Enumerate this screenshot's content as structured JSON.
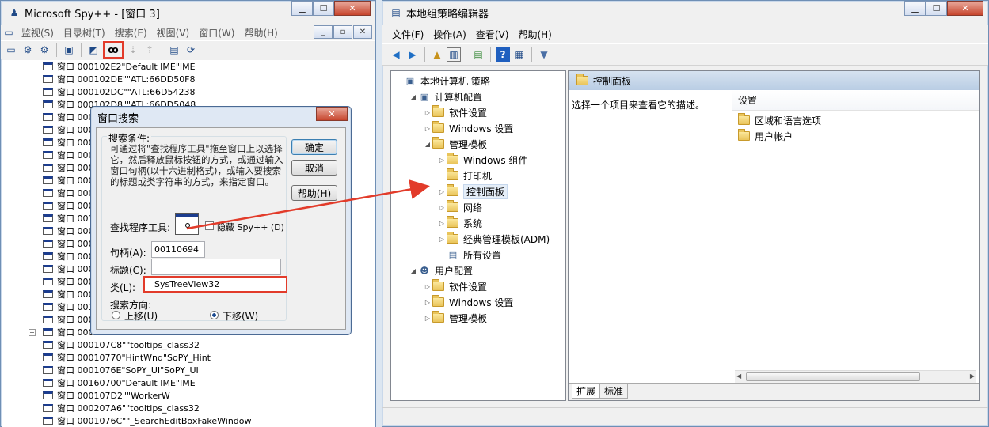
{
  "spy": {
    "title": "Microsoft Spy++ - [窗口 3]",
    "menu": [
      "监视(S)",
      "目录树(T)",
      "搜索(E)",
      "视图(V)",
      "窗口(W)",
      "帮助(H)"
    ],
    "tree": [
      "窗口 000102E2\"Default IME\"IME",
      "窗口 000102DE\"\"ATL:66DD50F8",
      "窗口 000102DC\"\"ATL:66D54238",
      "窗口 000102D8\"\"ATL:66DD5048",
      "窗口 000",
      "窗口 000",
      "窗口 000",
      "窗口 000",
      "窗口 000",
      "窗口 000",
      "窗口 000",
      "窗口 000",
      "窗口 001",
      "窗口 000",
      "窗口 000",
      "窗口 000",
      "窗口 000",
      "窗口 000",
      "窗口 000",
      "窗口 001",
      "窗口 000",
      "窗口 000",
      "窗口 000107C8\"\"tooltips_class32",
      "窗口 00010770\"HintWnd\"SoPY_Hint",
      "窗口 0001076E\"SoPY_UI\"SoPY_UI",
      "窗口 00160700\"Default IME\"IME",
      "窗口 000107D2\"\"WorkerW",
      "窗口 000207A6\"\"tooltips_class32",
      "窗口 0001076C\"\"_SearchEditBoxFakeWindow"
    ]
  },
  "dialog": {
    "title": "窗口搜索",
    "group_label": "搜索条件:",
    "description": "可通过将\"查找程序工具\"拖至窗口上以选择它，然后释放鼠标按钮的方式，或通过输入窗口句柄(以十六进制格式)，或输入要搜索的标题或类字符串的方式，来指定窗口。",
    "ok": "确定",
    "cancel": "取消",
    "help": "帮助(H)",
    "finder_label": "查找程序工具:",
    "hide_label": "隐藏 Spy++ (D)",
    "handle_label": "句柄(A):",
    "handle_value": "00110694",
    "caption_label": "标题(C):",
    "caption_value": "",
    "class_label": "类(L):",
    "class_value": "SysTreeView32",
    "direction_label": "搜索方向:",
    "up_label": "上移(U)",
    "down_label": "下移(W)"
  },
  "gpedit": {
    "title": "本地组策略编辑器",
    "menu": [
      "文件(F)",
      "操作(A)",
      "查看(V)",
      "帮助(H)"
    ],
    "tree": [
      {
        "label": "本地计算机 策略",
        "level": 0,
        "icon": "computer-icon",
        "tri": ""
      },
      {
        "label": "计算机配置",
        "level": 1,
        "icon": "computer-icon",
        "tri": "◢"
      },
      {
        "label": "软件设置",
        "level": 2,
        "icon": "folder-icon",
        "tri": "▷"
      },
      {
        "label": "Windows 设置",
        "level": 2,
        "icon": "folder-icon",
        "tri": "▷"
      },
      {
        "label": "管理模板",
        "level": 2,
        "icon": "folder-icon",
        "tri": "◢"
      },
      {
        "label": "Windows 组件",
        "level": 3,
        "icon": "folder-icon",
        "tri": "▷"
      },
      {
        "label": "打印机",
        "level": 3,
        "icon": "folder-icon",
        "tri": ""
      },
      {
        "label": "控制面板",
        "level": 3,
        "icon": "folder-icon",
        "tri": "▷",
        "selected": true
      },
      {
        "label": "网络",
        "level": 3,
        "icon": "folder-icon",
        "tri": "▷"
      },
      {
        "label": "系统",
        "level": 3,
        "icon": "folder-icon",
        "tri": "▷"
      },
      {
        "label": "经典管理模板(ADM)",
        "level": 3,
        "icon": "folder-icon",
        "tri": "▷"
      },
      {
        "label": "所有设置",
        "level": 3,
        "icon": "settings-icon",
        "tri": ""
      },
      {
        "label": "用户配置",
        "level": 1,
        "icon": "user-icon",
        "tri": "◢"
      },
      {
        "label": "软件设置",
        "level": 2,
        "icon": "folder-icon",
        "tri": "▷"
      },
      {
        "label": "Windows 设置",
        "level": 2,
        "icon": "folder-icon",
        "tri": "▷"
      },
      {
        "label": "管理模板",
        "level": 2,
        "icon": "folder-icon",
        "tri": "▷"
      }
    ],
    "right_header": "控制面板",
    "description": "选择一个项目来查看它的描述。",
    "settings_header": "设置",
    "settings_items": [
      "区域和语言选项",
      "用户帐户"
    ],
    "tabs": [
      "扩展",
      "标准"
    ]
  }
}
